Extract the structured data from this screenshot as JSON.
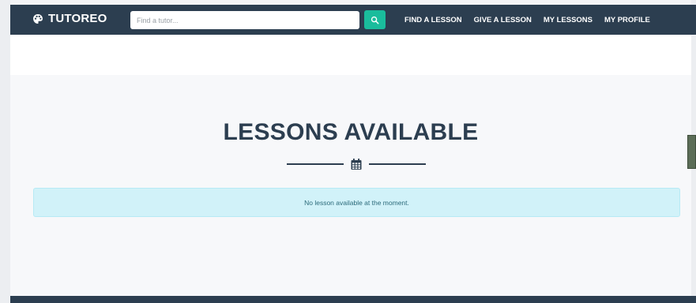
{
  "brand": {
    "name": "TUTOREO",
    "icon": "palette-icon"
  },
  "search": {
    "placeholder": "Find a tutor...",
    "value": "",
    "button_icon": "search-icon"
  },
  "nav": {
    "items": [
      {
        "label": "FIND A LESSON"
      },
      {
        "label": "GIVE A LESSON"
      },
      {
        "label": "MY LESSONS"
      },
      {
        "label": "MY PROFILE"
      }
    ]
  },
  "main": {
    "title": "LESSONS AVAILABLE",
    "divider_icon": "calendar-icon",
    "alert": "No lesson available at the moment."
  },
  "side_tab": {
    "label": ""
  },
  "colors": {
    "navbar": "#2c3e50",
    "accent": "#1abc9c",
    "alert_bg": "#d1f2f9",
    "alert_text": "#2b6a7a",
    "title": "#2c3e50"
  }
}
